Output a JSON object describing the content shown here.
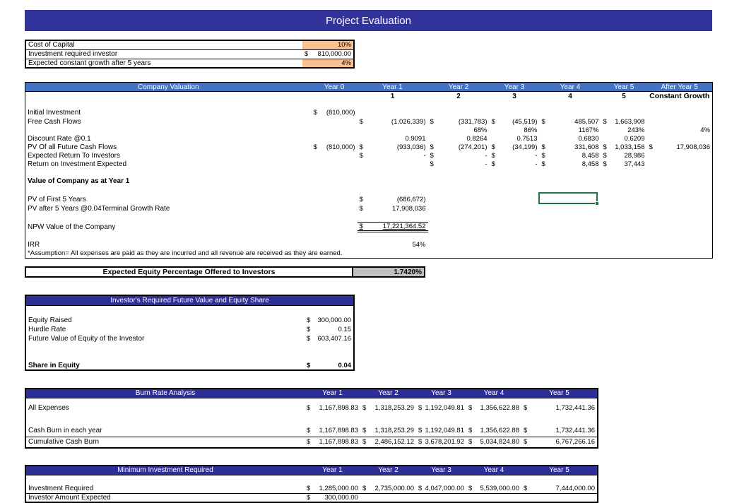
{
  "title": "Project Evaluation",
  "sym": {
    "dollar": "$"
  },
  "colors": {
    "title_bar": "#32329B",
    "section_header": "#2E2E99",
    "cv_header": "#4472C4",
    "input_highlight": "#FAC090",
    "gray_cell": "#BFBFBF",
    "selection_green": "#217346"
  },
  "inputs": {
    "cost_label": "Cost of Capital",
    "cost_value": "10%",
    "invest_label": "Investment required investor",
    "invest_value": "810,000.00",
    "growth_label": "Expected constant growth after 5 years",
    "growth_value": "4%"
  },
  "cv": {
    "title": "Company Valuation",
    "cols": {
      "y0": "Year 0",
      "y1": "Year 1",
      "y2": "Year 2",
      "y3": "Year 3",
      "y4": "Year 4",
      "y5": "Year 5",
      "after": "After Year 5"
    },
    "sub": {
      "y1": "1",
      "y2": "2",
      "y3": "3",
      "y4": "4",
      "y5": "5",
      "after": "Constant Growth"
    },
    "initial": {
      "label": "Initial Investment",
      "y0": "(810,000)"
    },
    "fcf": {
      "label": "Free Cash Flows",
      "y1": "(1,026,339)",
      "y2": "(331,783)",
      "y3": "(45,519)",
      "y4": "485,507",
      "y5": "1,663,908"
    },
    "pct": {
      "y2": "68%",
      "y3": "86%",
      "y4": "1167%",
      "y5": "243%",
      "after": "4%"
    },
    "discount": {
      "label": "Discount Rate @0.1",
      "y1": "0.9091",
      "y2": "0.8264",
      "y3": "0.7513",
      "y4": "0.6830",
      "y5": "0.6209"
    },
    "pv_all": {
      "label": "PV Of all Future Cash Flows",
      "y0": "(810,000)",
      "y1": "(933,036)",
      "y2": "(274,201)",
      "y3": "(34,199)",
      "y4": "331,608",
      "y5": "1,033,156",
      "after": "17,908,036"
    },
    "exp_return": {
      "label": "Expected Return To Investors",
      "y1": "-",
      "y2": "-",
      "y3": "-",
      "y4": "8,458",
      "y5": "28,986"
    },
    "roi": {
      "label": "Return on Investment Expected",
      "y2": "-",
      "y3": "-",
      "y4": "8,458",
      "y5": "37,443"
    },
    "value_heading": "Value of Company as at Year 1",
    "pv_first5": {
      "label": "PV of First 5 Years",
      "y1": "(686,672)"
    },
    "pv_after5": {
      "label": "PV after 5 Years @0.04Terminal Growth Rate",
      "y1": "17,908,036"
    },
    "npw": {
      "label": "NPW Value of the Company",
      "y1": "17,221,364.52"
    },
    "irr": {
      "label": "IRR",
      "y1": "54%"
    },
    "assumption": "*Assumption= All expenses are paid as they are incurred and all revenue are received as they are earned."
  },
  "equity_offer": {
    "label": "Expected Equity Percentage Offered to Investors",
    "value": "1.7420%"
  },
  "investor": {
    "title": "Investor's Required Future Value and Equity Share",
    "equity_raised": {
      "label": "Equity Raised",
      "value": "300,000.00"
    },
    "hurdle": {
      "label": "Hurdle Rate",
      "value": "0.15"
    },
    "future_value": {
      "label": "Future Value of Equity of the Investor",
      "value": "603,407.16"
    },
    "share": {
      "label": "Share in Equity",
      "value": "0.04"
    }
  },
  "burn": {
    "title": "Burn Rate Analysis",
    "cols": {
      "y1": "Year 1",
      "y2": "Year 2",
      "y3": "Year 3",
      "y4": "Year 4",
      "y5": "Year 5"
    },
    "all_expenses": {
      "label": "All Expenses",
      "y1": "1,167,898.83",
      "y2": "1,318,253.29",
      "y3": "1,192,049.81",
      "y4": "1,356,622.88",
      "y5": "1,732,441.36"
    },
    "cash_burn": {
      "label": "Cash Burn in each year",
      "y1": "1,167,898.83",
      "y2": "1,318,253.29",
      "y3": "1,192,049.81",
      "y4": "1,356,622.88",
      "y5": "1,732,441.36"
    },
    "cumulative": {
      "label": "Cumulative Cash Burn",
      "y1": "1,167,898.83",
      "y2": "2,486,152.12",
      "y3": "3,678,201.92",
      "y4": "5,034,824.80",
      "y5": "6,767,266.16"
    }
  },
  "min_invest": {
    "title": "Minimum Investment Required",
    "cols": {
      "y1": "Year 1",
      "y2": "Year 2",
      "y3": "Year 3",
      "y4": "Year 4",
      "y5": "Year 5"
    },
    "required": {
      "label": "Investment Required",
      "y1": "1,285,000.00",
      "y2": "2,735,000.00",
      "y3": "4,047,000.00",
      "y4": "5,539,000.00",
      "y5": "7,444,000.00"
    },
    "expected": {
      "label": "Investor Amount Expected",
      "y1": "300,000.00"
    }
  }
}
